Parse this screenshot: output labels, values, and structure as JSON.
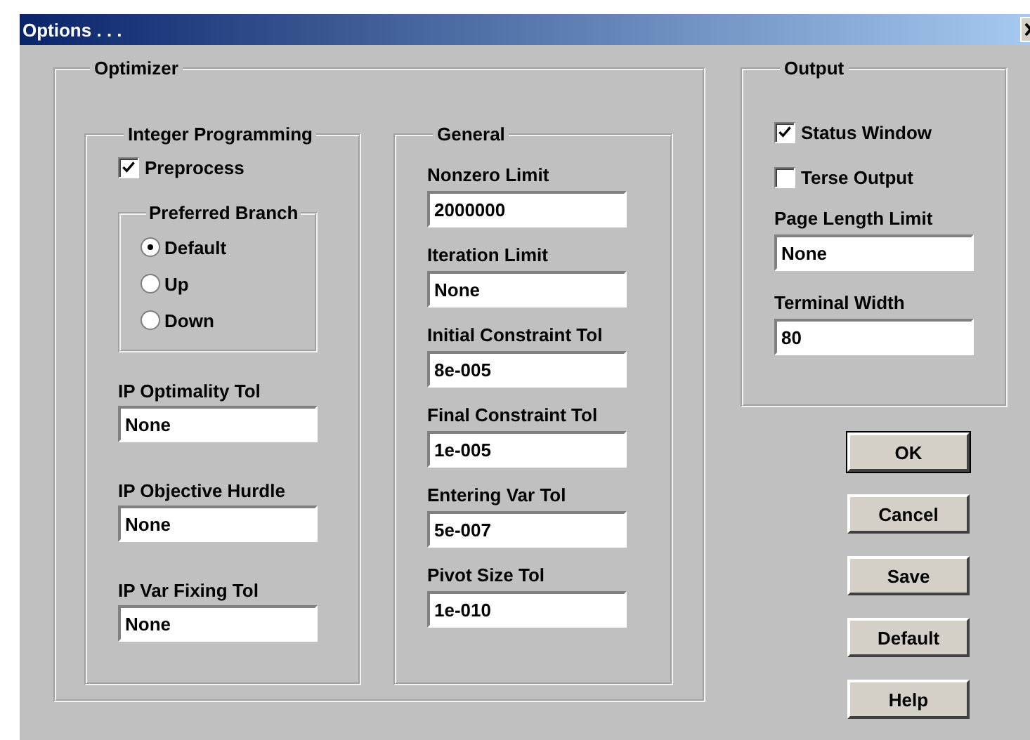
{
  "window": {
    "title": "Options . . ."
  },
  "optimizer": {
    "title": "Optimizer",
    "integer_programming": {
      "title": "Integer Programming",
      "preprocess": {
        "label": "Preprocess",
        "checked": true
      },
      "preferred_branch": {
        "title": "Preferred Branch",
        "options": [
          {
            "label": "Default",
            "selected": true
          },
          {
            "label": "Up",
            "selected": false
          },
          {
            "label": "Down",
            "selected": false
          }
        ]
      },
      "fields": [
        {
          "label": "IP Optimality Tol",
          "value": "None"
        },
        {
          "label": "IP Objective Hurdle",
          "value": "None"
        },
        {
          "label": "IP Var Fixing Tol",
          "value": "None"
        }
      ]
    },
    "general": {
      "title": "General",
      "fields": [
        {
          "label": "Nonzero Limit",
          "value": "2000000"
        },
        {
          "label": "Iteration Limit",
          "value": "None"
        },
        {
          "label": "Initial Constraint Tol",
          "value": "8e-005"
        },
        {
          "label": "Final Constraint Tol",
          "value": "1e-005"
        },
        {
          "label": "Entering Var Tol",
          "value": "5e-007"
        },
        {
          "label": "Pivot Size Tol",
          "value": "1e-010"
        }
      ]
    }
  },
  "output": {
    "title": "Output",
    "checkboxes": [
      {
        "label": "Status Window",
        "checked": true
      },
      {
        "label": "Terse Output",
        "checked": false
      }
    ],
    "fields": [
      {
        "label": "Page Length Limit",
        "value": "None"
      },
      {
        "label": "Terminal Width",
        "value": "80"
      }
    ]
  },
  "buttons": [
    {
      "label": "OK",
      "default": true
    },
    {
      "label": "Cancel",
      "default": false
    },
    {
      "label": "Save",
      "default": false
    },
    {
      "label": "Default",
      "default": false
    },
    {
      "label": "Help",
      "default": false
    }
  ]
}
